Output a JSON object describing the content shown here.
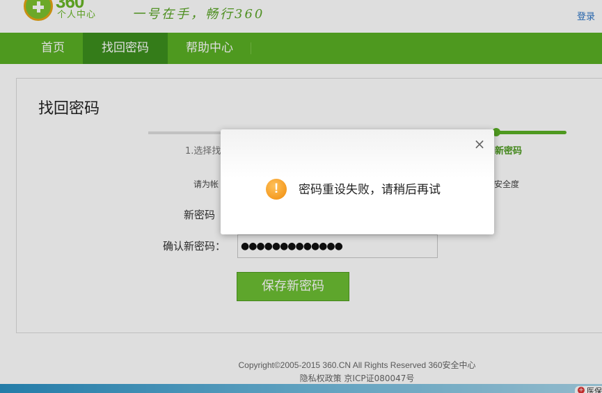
{
  "header": {
    "logo_number": "360",
    "logo_subtitle": "个人中心",
    "slogan": "一号在手，畅行360",
    "login_link": "登录"
  },
  "nav": {
    "items": [
      {
        "label": "首页",
        "active": false
      },
      {
        "label": "找回密码",
        "active": true
      },
      {
        "label": "帮助中心",
        "active": false
      }
    ]
  },
  "main": {
    "page_title": "找回密码",
    "steps": {
      "step1_label_partial": "1.选择找",
      "step3_label_partial": "新密码"
    },
    "hint_partial": "请为帐",
    "strength_label_partial": "安全度",
    "form": {
      "new_password_label": "新密码",
      "confirm_password_label": "确认新密码：",
      "confirm_password_value": "●●●●●●●●●●●●●"
    },
    "save_button": "保存新密码"
  },
  "footer": {
    "copyright": "Copyright©2005-2015 360.CN All Rights Reserved 360安全中心",
    "icp": "隐私权政策 京ICP证080047号"
  },
  "corner_badge": {
    "icon": "+",
    "text": "医保"
  },
  "dialog": {
    "close_glyph": "×",
    "icon_glyph": "!",
    "message": "密码重设失败，请稍后再试"
  },
  "colors": {
    "brand_green": "#5ab024",
    "active_nav": "#3c8f1d",
    "button_green": "#6cbf33",
    "warning_orange": "#f08b0a",
    "link_blue": "#2b73c5"
  }
}
